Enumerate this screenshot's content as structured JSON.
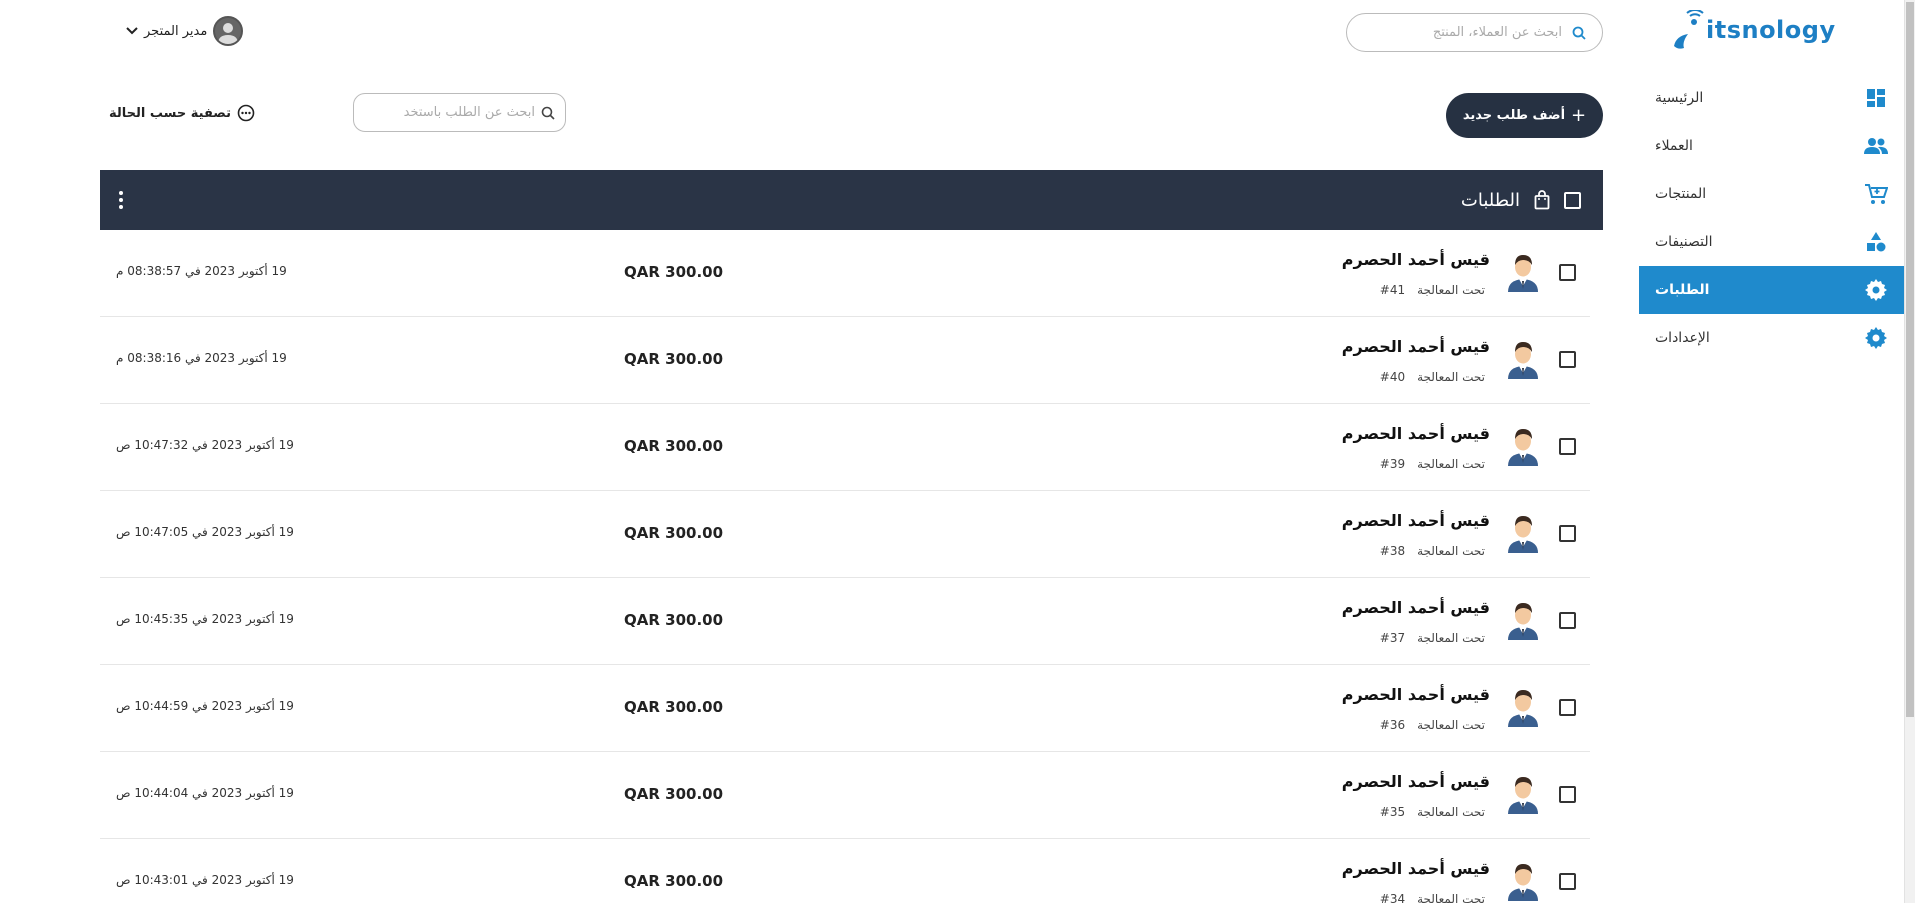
{
  "brand": {
    "logo_text": "itsnology"
  },
  "header": {
    "search_placeholder": "ابحث عن العملاء، المنتج",
    "user_name": "مدير المتجر"
  },
  "sidebar": {
    "items": [
      {
        "label": "الرئيسية",
        "icon": "dashboard-icon"
      },
      {
        "label": "العملاء",
        "icon": "people-icon"
      },
      {
        "label": "المنتجات",
        "icon": "cart-icon"
      },
      {
        "label": "التصنيفات",
        "icon": "shapes-icon"
      },
      {
        "label": "الطلبات",
        "icon": "gear-icon",
        "active": true
      },
      {
        "label": "الإعدادات",
        "icon": "gear-icon"
      }
    ]
  },
  "toolbar": {
    "add_label": "أضف طلب جديد",
    "order_search_placeholder": "ابحث عن الطلب باستخد",
    "filter_label": "تصفية حسب الحالة"
  },
  "orders": {
    "title": "الطلبات",
    "rows": [
      {
        "name": "قيس أحمد الحصرم",
        "number": "#41",
        "status": "تحت المعالجة",
        "amount": "QAR 300.00",
        "date": "19 أكتوبر 2023 في 08:38:57 م"
      },
      {
        "name": "قيس أحمد الحصرم",
        "number": "#40",
        "status": "تحت المعالجة",
        "amount": "QAR 300.00",
        "date": "19 أكتوبر 2023 في 08:38:16 م"
      },
      {
        "name": "قيس أحمد الحصرم",
        "number": "#39",
        "status": "تحت المعالجة",
        "amount": "QAR 300.00",
        "date": "19 أكتوبر 2023 في 10:47:32 ص"
      },
      {
        "name": "قيس أحمد الحصرم",
        "number": "#38",
        "status": "تحت المعالجة",
        "amount": "QAR 300.00",
        "date": "19 أكتوبر 2023 في 10:47:05 ص"
      },
      {
        "name": "قيس أحمد الحصرم",
        "number": "#37",
        "status": "تحت المعالجة",
        "amount": "QAR 300.00",
        "date": "19 أكتوبر 2023 في 10:45:35 ص"
      },
      {
        "name": "قيس أحمد الحصرم",
        "number": "#36",
        "status": "تحت المعالجة",
        "amount": "QAR 300.00",
        "date": "19 أكتوبر 2023 في 10:44:59 ص"
      },
      {
        "name": "قيس أحمد الحصرم",
        "number": "#35",
        "status": "تحت المعالجة",
        "amount": "QAR 300.00",
        "date": "19 أكتوبر 2023 في 10:44:04 ص"
      },
      {
        "name": "قيس أحمد الحصرم",
        "number": "#34",
        "status": "تحت المعالجة",
        "amount": "QAR 300.00",
        "date": "19 أكتوبر 2023 في 10:43:01 ص"
      }
    ]
  },
  "colors": {
    "accent": "#1f8acc",
    "header_dark": "#2a3446",
    "button_dark": "#263142"
  }
}
